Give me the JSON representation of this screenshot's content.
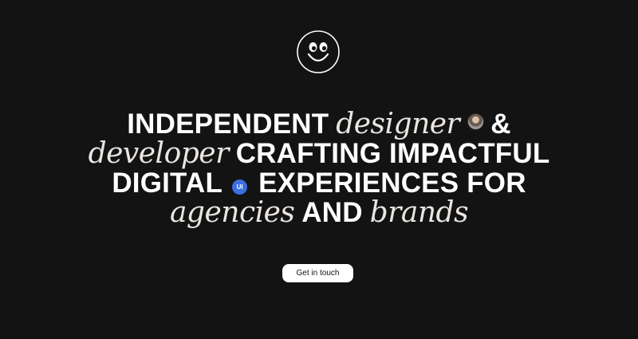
{
  "logo": {
    "icon": "smiley-face-icon"
  },
  "headline": {
    "line1": {
      "word1": "INDEPENDENT",
      "word2": "designer",
      "word3": "&"
    },
    "line2": {
      "word1": "developer",
      "word2": "CRAFTING IMPACTFUL"
    },
    "line3": {
      "word1": "DIGITAL",
      "badge": "UI",
      "word2": "EXPERIENCES FOR"
    },
    "line4": {
      "word1": "agencies",
      "word2": "AND",
      "word3": "brands"
    }
  },
  "cta": {
    "label": "Get in touch"
  },
  "colors": {
    "background": "#141313",
    "text": "#ffffff",
    "badge": "#3b6fe0",
    "button": "#ffffff"
  }
}
